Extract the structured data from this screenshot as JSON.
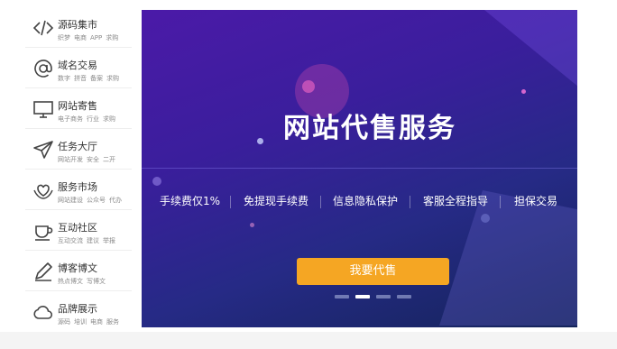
{
  "sidebar": {
    "items": [
      {
        "title": "源码集市",
        "icon": "code-icon",
        "tags": [
          "织梦",
          "电商",
          "APP",
          "求购"
        ]
      },
      {
        "title": "域名交易",
        "icon": "at-sign-icon",
        "tags": [
          "数字",
          "拼音",
          "备案",
          "求购"
        ]
      },
      {
        "title": "网站寄售",
        "icon": "monitor-icon",
        "tags": [
          "电子商务",
          "行业",
          "求购"
        ]
      },
      {
        "title": "任务大厅",
        "icon": "paper-plane-icon",
        "tags": [
          "网站开发",
          "安全",
          "二开"
        ]
      },
      {
        "title": "服务市场",
        "icon": "heart-hands-icon",
        "tags": [
          "网站建设",
          "公众号",
          "代办"
        ]
      },
      {
        "title": "互动社区",
        "icon": "cup-icon",
        "tags": [
          "互动交流",
          "建议",
          "举报"
        ]
      },
      {
        "title": "博客博文",
        "icon": "pen-icon",
        "tags": [
          "热点博文",
          "写博文"
        ]
      },
      {
        "title": "品牌展示",
        "icon": "cloud-icon",
        "tags": [
          "源码",
          "培训",
          "电商",
          "服务"
        ]
      }
    ]
  },
  "banner": {
    "headline": "网站代售服务",
    "features": [
      "手续费仅1%",
      "免提现手续费",
      "信息隐私保护",
      "客服全程指导",
      "担保交易"
    ],
    "cta_label": "我要代售",
    "carousel": {
      "count": 4,
      "active_index": 1
    },
    "colors": {
      "cta": "#f5a623",
      "background_top": "#4b1aa8",
      "background_bottom": "#14245a"
    }
  }
}
